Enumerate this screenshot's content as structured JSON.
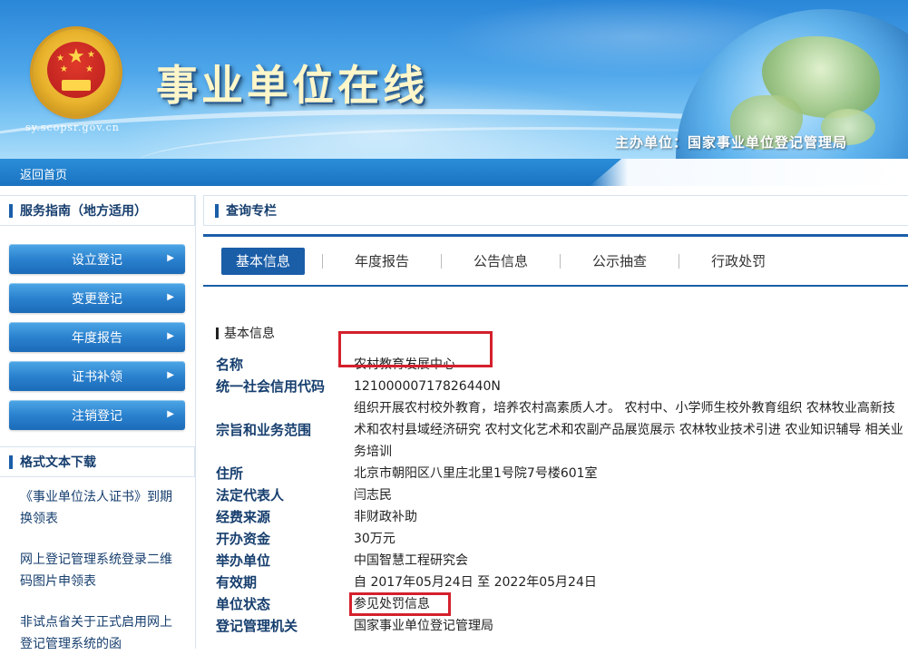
{
  "header": {
    "site_title": "事业单位在线",
    "site_url": "sy.scopsr.gov.cn",
    "organizer": "主办单位：国家事业单位登记管理局"
  },
  "nav": {
    "home_label": "返回首页"
  },
  "sidebar": {
    "guide_title": "服务指南（地方适用）",
    "menu": [
      {
        "label": "设立登记"
      },
      {
        "label": "变更登记"
      },
      {
        "label": "年度报告"
      },
      {
        "label": "证书补领"
      },
      {
        "label": "注销登记"
      }
    ],
    "download_title": "格式文本下载",
    "docs": [
      {
        "label": "《事业单位法人证书》到期换领表"
      },
      {
        "label": "网上登记管理系统登录二维码图片申领表"
      },
      {
        "label": "非试点省关于正式启用网上登记管理系统的函"
      }
    ]
  },
  "main": {
    "column_title": "查询专栏",
    "tabs": [
      {
        "label": "基本信息",
        "active": true
      },
      {
        "label": "年度报告"
      },
      {
        "label": "公告信息"
      },
      {
        "label": "公示抽查"
      },
      {
        "label": "行政处罚"
      }
    ],
    "section_title": "基本信息",
    "fields": [
      {
        "key": "名称",
        "value": "农村教育发展中心"
      },
      {
        "key": "统一社会信用代码",
        "value": "12100000717826440N"
      },
      {
        "key": "宗旨和业务范围",
        "value": "组织开展农村校外教育，培养农村高素质人才。 农村中、小学师生校外教育组织 农林牧业高新技术和农村县域经济研究 农村文化艺术和农副产品展览展示 农林牧业技术引进 农业知识辅导 相关业务培训"
      },
      {
        "key": "住所",
        "value": "北京市朝阳区八里庄北里1号院7号楼601室"
      },
      {
        "key": "法定代表人",
        "value": "闫志民"
      },
      {
        "key": "经费来源",
        "value": "非财政补助"
      },
      {
        "key": "开办资金",
        "value": "30万元"
      },
      {
        "key": "举办单位",
        "value": "中国智慧工程研究会"
      },
      {
        "key": "有效期",
        "value": "自 2017年05月24日 至 2022年05月24日"
      },
      {
        "key": "单位状态",
        "value": "参见处罚信息"
      },
      {
        "key": "登记管理机关",
        "value": "国家事业单位登记管理局"
      }
    ]
  },
  "colors": {
    "primary": "#1a5ea8",
    "highlight": "#d4202c",
    "label": "#163e6e"
  }
}
